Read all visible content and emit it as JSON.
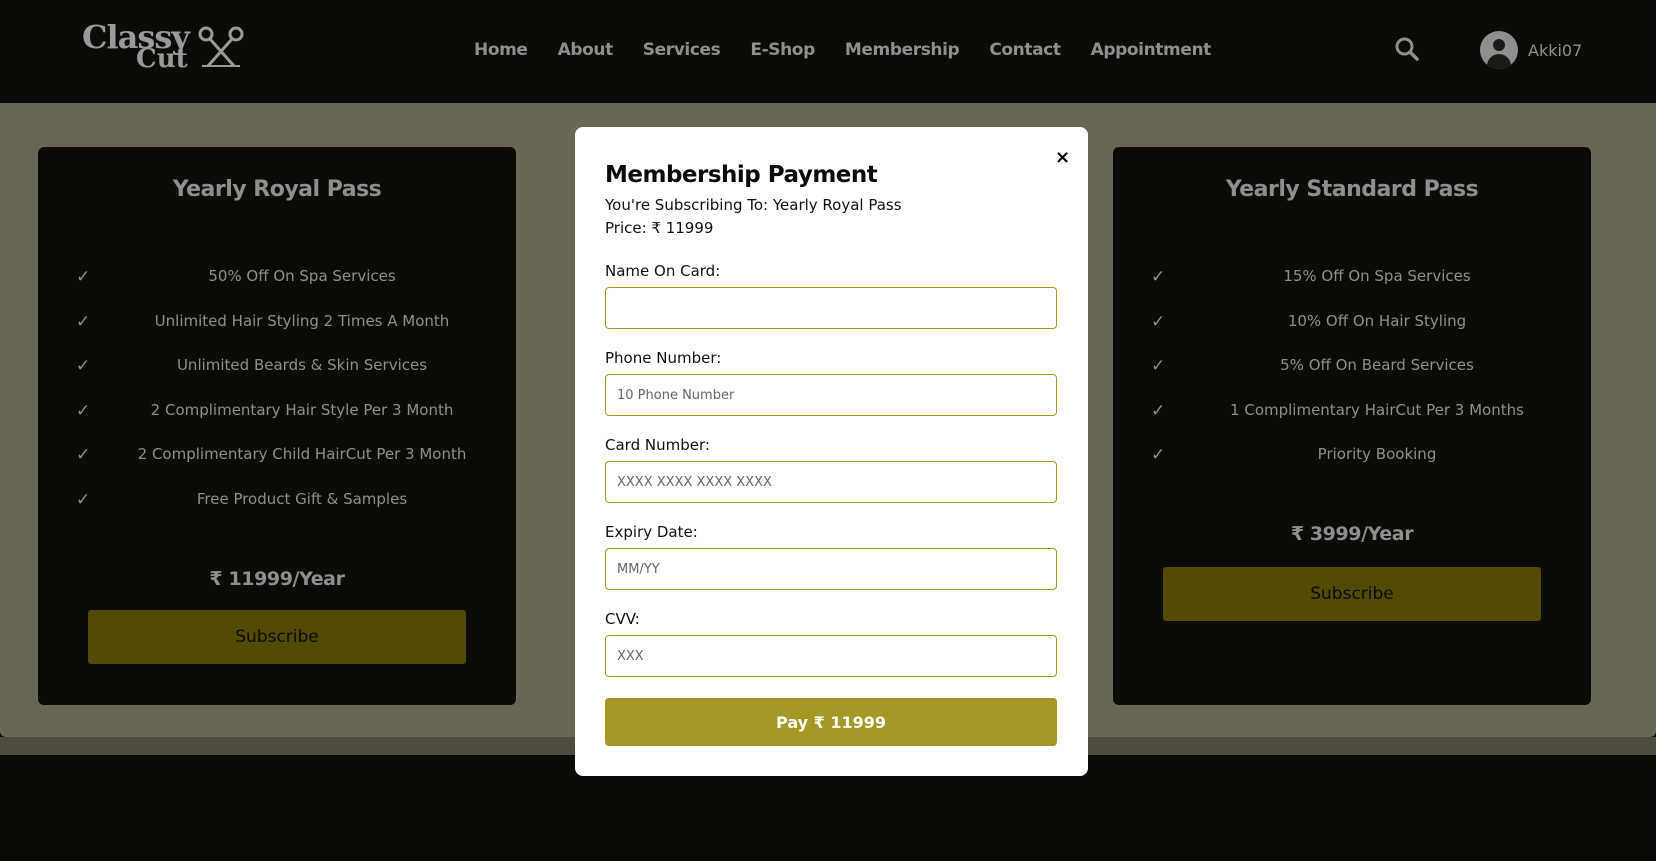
{
  "brand": {
    "line1": "Classy",
    "line2": "Cut"
  },
  "nav": {
    "items": [
      "Home",
      "About",
      "Services",
      "E-Shop",
      "Membership",
      "Contact",
      "Appointment"
    ]
  },
  "user": {
    "name": "Akki07"
  },
  "cards": {
    "left": {
      "title": "Yearly Royal Pass",
      "check": "✓",
      "features": [
        "50% Off On Spa Services",
        "Unlimited Hair Styling 2 Times A Month",
        "Unlimited Beards & Skin Services",
        "2 Complimentary Hair Style Per 3 Month",
        "2 Complimentary Child HairCut Per 3 Month",
        "Free Product Gift & Samples"
      ],
      "price": "₹ 11999/Year",
      "button": "Subscribe"
    },
    "right": {
      "title": "Yearly Standard Pass",
      "check": "✓",
      "features": [
        "15% Off On Spa Services",
        "10% Off On Hair Styling",
        "5% Off On Beard Services",
        "1 Complimentary HairCut Per 3 Months",
        "Priority Booking"
      ],
      "price": "₹ 3999/Year",
      "button": "Subscribe"
    }
  },
  "modal": {
    "close": "×",
    "title": "Membership Payment",
    "subscribing": "You're Subscribing To: Yearly Royal Pass",
    "price": "Price: ₹ 11999",
    "fields": {
      "name": {
        "label": "Name On Card:",
        "placeholder": "",
        "value": ""
      },
      "phone": {
        "label": "Phone Number:",
        "placeholder": "10 Phone Number",
        "value": ""
      },
      "card": {
        "label": "Card Number:",
        "placeholder": "XXXX XXXX XXXX XXXX",
        "value": ""
      },
      "expiry": {
        "label": "Expiry Date:",
        "placeholder": "MM/YY",
        "value": ""
      },
      "cvv": {
        "label": "CVV:",
        "placeholder": "XXX",
        "value": ""
      }
    },
    "pay_button": "Pay ₹ 11999"
  },
  "colors": {
    "accent": "#a29823",
    "accent_dim": "#534a06",
    "background": "#0b0b08",
    "overlay_band": "#6a6656",
    "muted_text": "#8f8f8f"
  },
  "icons": {
    "search": "search-icon",
    "user": "user-avatar-icon",
    "close": "close-icon",
    "check": "check-icon",
    "logo": "scissors-icon"
  }
}
